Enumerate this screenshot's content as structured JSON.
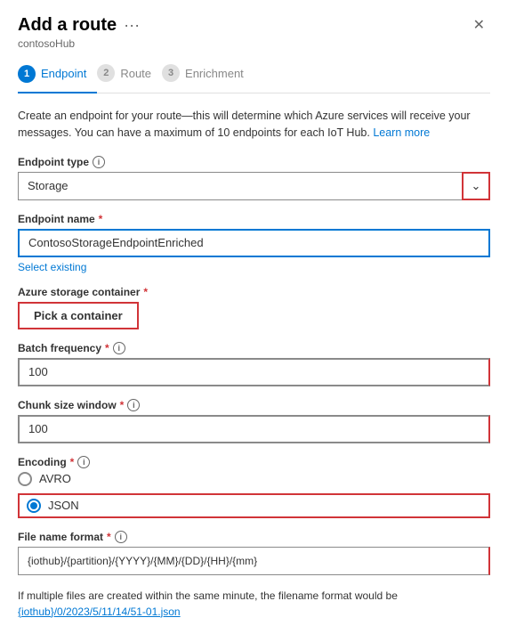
{
  "panel": {
    "title": "Add a route",
    "subtitle": "contosoHub",
    "close_label": "✕",
    "more_label": "···"
  },
  "steps": [
    {
      "number": "1",
      "label": "Endpoint",
      "active": true
    },
    {
      "number": "2",
      "label": "Route",
      "active": false
    },
    {
      "number": "3",
      "label": "Enrichment",
      "active": false
    }
  ],
  "description": "Create an endpoint for your route—this will determine which Azure services will receive your messages. You can have a maximum of 10 endpoints for each IoT Hub.",
  "learn_more": "Learn more",
  "endpoint_type": {
    "label": "Endpoint type",
    "value": "Storage",
    "required": false
  },
  "endpoint_name": {
    "label": "Endpoint name",
    "value": "ContosoStorageEndpointEnriched",
    "required": true
  },
  "select_existing": "Select existing",
  "azure_container": {
    "label": "Azure storage container",
    "required": true
  },
  "pick_container_btn": "Pick a container",
  "batch_frequency": {
    "label": "Batch frequency",
    "value": "100",
    "required": true
  },
  "chunk_size": {
    "label": "Chunk size window",
    "value": "100",
    "required": true
  },
  "encoding": {
    "label": "Encoding",
    "required": true,
    "options": [
      {
        "label": "AVRO",
        "checked": false
      },
      {
        "label": "JSON",
        "checked": true
      }
    ]
  },
  "filename_format": {
    "label": "File name format",
    "value": "{iothub}/{partition}/{YYYY}/{MM}/{DD}/{HH}/{mm}",
    "required": true
  },
  "footer": {
    "line1": "If multiple files are created within the same minute, the filename format would be",
    "line2": "{iothub}/0/2023/5/11/14/51-01.json"
  }
}
